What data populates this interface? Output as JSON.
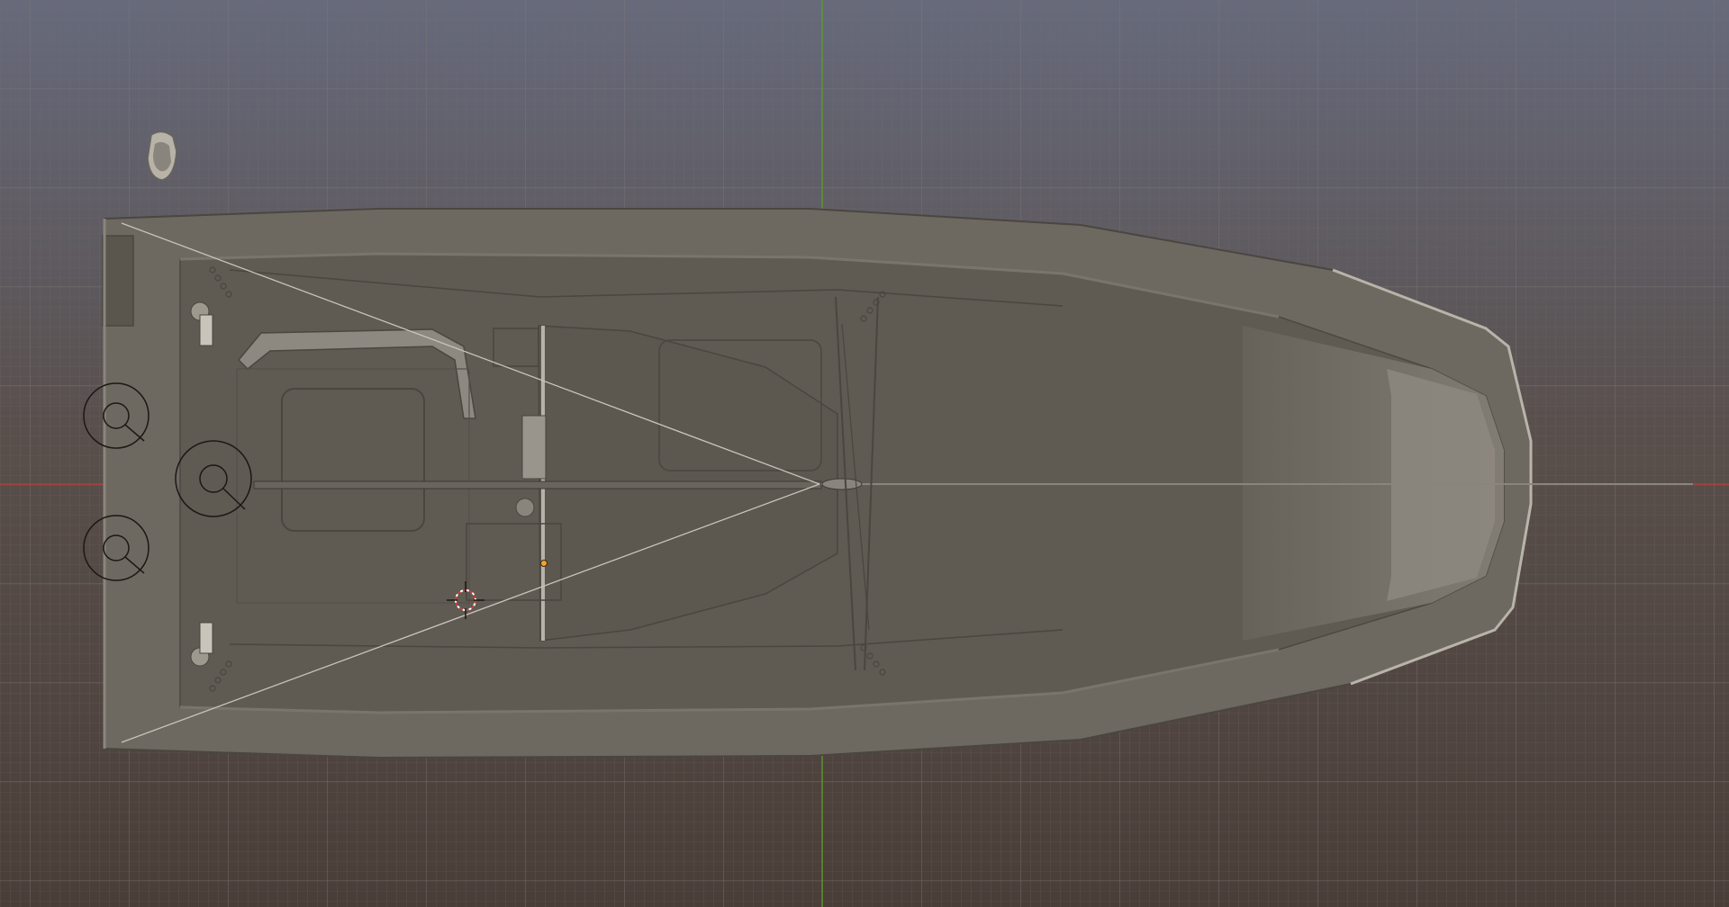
{
  "viewport": {
    "background_top": "#666a7c",
    "background_bottom": "#4a3e38",
    "grid_color": "#7a6a64",
    "axis_x_color": "#c23a3a",
    "axis_y_color": "#5f9a2a"
  },
  "model": {
    "hull_outer": "#6e6960",
    "hull_deck": "#5f5950",
    "hull_light": "#8a857c",
    "edge": "#3f3b35"
  },
  "icons": {
    "cursor": "3d-cursor-icon",
    "origin": "object-origin-icon",
    "empty": "empty-circle-icon",
    "camera": "camera-object-icon"
  }
}
